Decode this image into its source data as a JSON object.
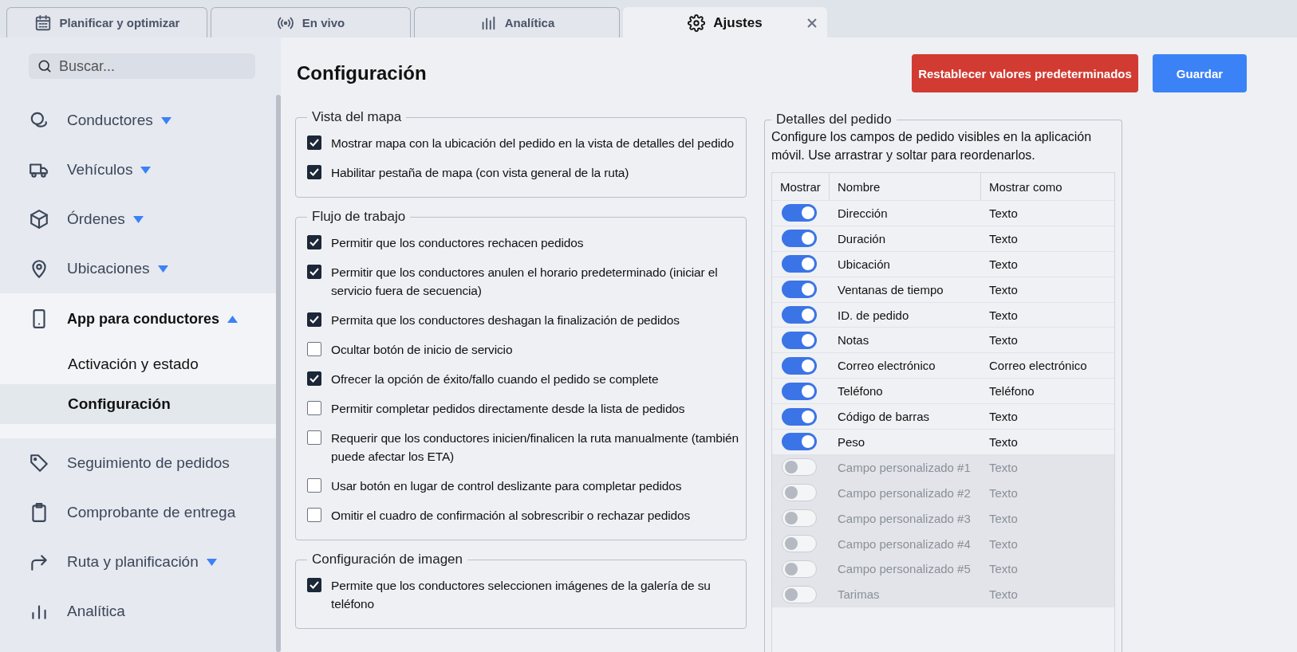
{
  "tabs": [
    {
      "label": "Planificar y optimizar",
      "selected": false
    },
    {
      "label": "En vivo",
      "selected": false
    },
    {
      "label": "Analítica",
      "selected": false
    },
    {
      "label": "Ajustes",
      "selected": true
    }
  ],
  "sidebar": {
    "search": {
      "placeholder": "Buscar..."
    },
    "items": [
      {
        "label": "Conductores",
        "kind": "group",
        "expanded": false
      },
      {
        "label": "Vehículos",
        "kind": "group",
        "expanded": false
      },
      {
        "label": "Órdenes",
        "kind": "group",
        "expanded": false
      },
      {
        "label": "Ubicaciones",
        "kind": "group",
        "expanded": false
      },
      {
        "label": "App para conductores",
        "kind": "group",
        "expanded": true,
        "children": [
          {
            "label": "Activación y estado",
            "selected": false
          },
          {
            "label": "Configuración",
            "selected": true
          }
        ]
      },
      {
        "label": "Seguimiento de pedidos",
        "kind": "link"
      },
      {
        "label": "Comprobante de entrega",
        "kind": "link"
      },
      {
        "label": "Ruta y planificación",
        "kind": "group",
        "expanded": false
      },
      {
        "label": "Analítica",
        "kind": "link"
      }
    ]
  },
  "page_title": "Configuración",
  "buttons": [
    {
      "label": "Restablecer valores predeterminados",
      "kind": "danger"
    },
    {
      "label": "Guardar",
      "kind": "primary"
    }
  ],
  "groups": [
    {
      "title": "Vista del mapa",
      "options": [
        {
          "label": "Mostrar mapa con la ubicación del pedido en la vista de detalles del pedido",
          "checked": true
        },
        {
          "label": "Habilitar pestaña de mapa (con vista general de la ruta)",
          "checked": true
        }
      ]
    },
    {
      "title": "Flujo de trabajo",
      "options": [
        {
          "label": "Permitir que los conductores rechacen pedidos",
          "checked": true
        },
        {
          "label": "Permitir que los conductores anulen el horario predeterminado (iniciar el servicio fuera de secuencia)",
          "checked": true
        },
        {
          "label": "Permita que los conductores deshagan la finalización de pedidos",
          "checked": true
        },
        {
          "label": "Ocultar botón de inicio de servicio",
          "checked": false
        },
        {
          "label": "Ofrecer la opción de éxito/fallo cuando el pedido se complete",
          "checked": true
        },
        {
          "label": "Permitir completar pedidos directamente desde la lista de pedidos",
          "checked": false
        },
        {
          "label": "Requerir que los conductores inicien/finalicen la ruta manualmente (también puede afectar los ETA)",
          "checked": false
        },
        {
          "label": "Usar botón en lugar de control deslizante para completar pedidos",
          "checked": false
        },
        {
          "label": "Omitir el cuadro de confirmación al sobrescribir o rechazar pedidos",
          "checked": false
        }
      ]
    },
    {
      "title": "Configuración de imagen",
      "options": [
        {
          "label": "Permite que los conductores seleccionen imágenes de la galería de su teléfono",
          "checked": true
        }
      ]
    }
  ],
  "order_details": {
    "title": "Detalles del pedido",
    "description": "Configure los campos de pedido visibles en la aplicación móvil. Use arrastrar y soltar para reordenarlos.",
    "columns": [
      "Mostrar",
      "Nombre",
      "Mostrar como"
    ],
    "rows": [
      {
        "name": "Dirección",
        "display_as": "Texto",
        "on": true
      },
      {
        "name": "Duración",
        "display_as": "Texto",
        "on": true
      },
      {
        "name": "Ubicación",
        "display_as": "Texto",
        "on": true
      },
      {
        "name": "Ventanas de tiempo",
        "display_as": "Texto",
        "on": true
      },
      {
        "name": "ID. de pedido",
        "display_as": "Texto",
        "on": true
      },
      {
        "name": "Notas",
        "display_as": "Texto",
        "on": true
      },
      {
        "name": "Correo electrónico",
        "display_as": "Correo electrónico",
        "on": true
      },
      {
        "name": "Teléfono",
        "display_as": "Teléfono",
        "on": true
      },
      {
        "name": "Código de barras",
        "display_as": "Texto",
        "on": true
      },
      {
        "name": "Peso",
        "display_as": "Texto",
        "on": true
      },
      {
        "name": "Campo personalizado #1",
        "display_as": "Texto",
        "on": false
      },
      {
        "name": "Campo personalizado #2",
        "display_as": "Texto",
        "on": false
      },
      {
        "name": "Campo personalizado #3",
        "display_as": "Texto",
        "on": false
      },
      {
        "name": "Campo personalizado #4",
        "display_as": "Texto",
        "on": false
      },
      {
        "name": "Campo personalizado #5",
        "display_as": "Texto",
        "on": false
      },
      {
        "name": "Tarimas",
        "display_as": "Texto",
        "on": false
      }
    ]
  }
}
